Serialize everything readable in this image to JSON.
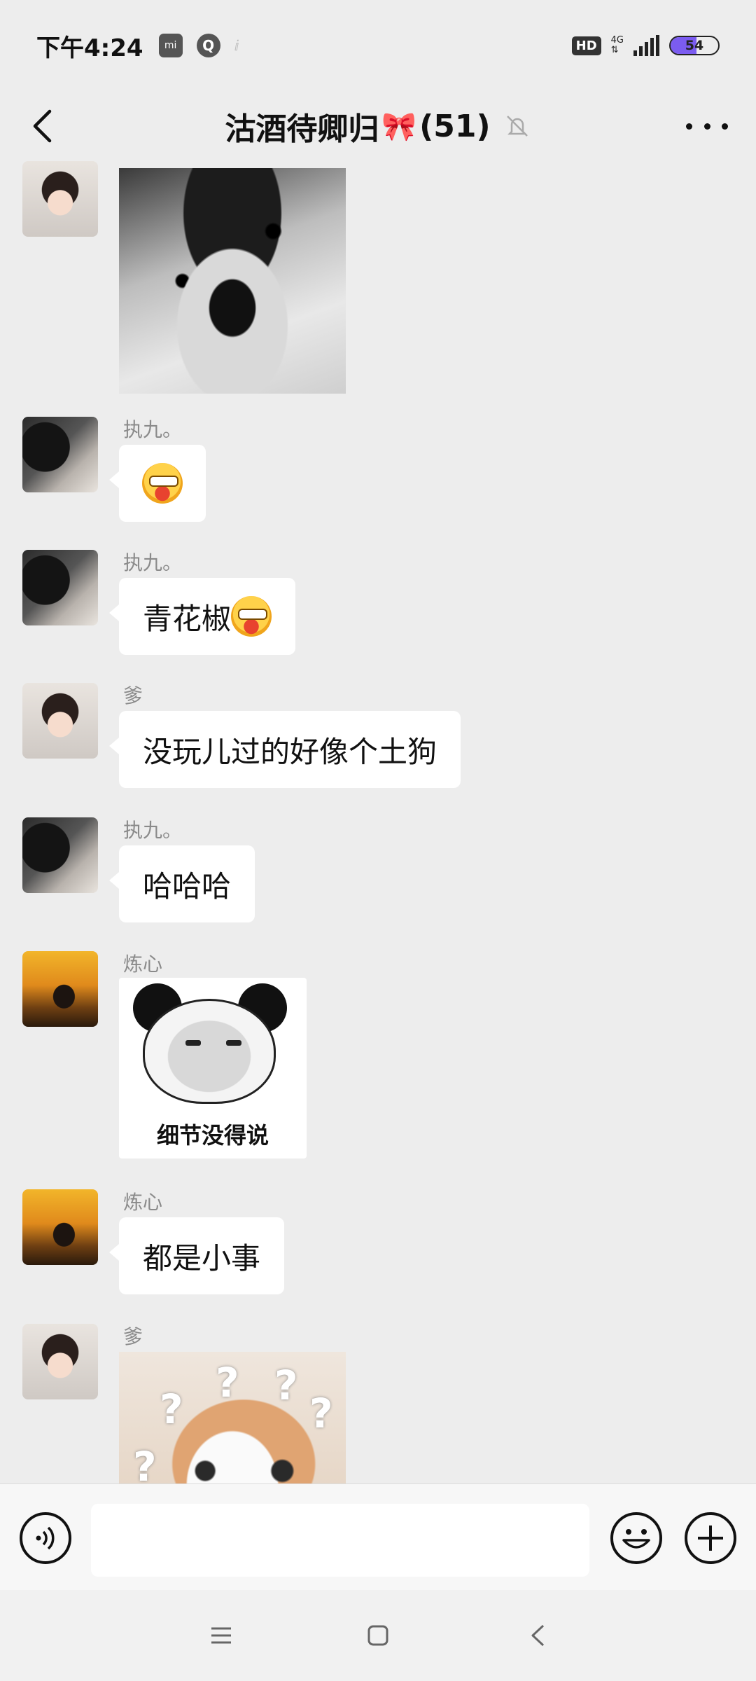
{
  "status_bar": {
    "time": "下午4:24",
    "mi_icon_label": "mi",
    "q_icon_label": "Q",
    "faint_icon": "ⅈ",
    "hd_label": "HD",
    "network_label": "4G",
    "network_arrows": "⇅",
    "battery_level": "54",
    "battery_fraction": 0.54
  },
  "header": {
    "title": "沽酒待卿归",
    "title_emoji": "🎀",
    "member_count": "(51)"
  },
  "messages": [
    {
      "type": "image",
      "sender": "爹",
      "avatar": "girl",
      "image": "husky-meme"
    },
    {
      "type": "text",
      "sender": "执九。",
      "avatar": "man",
      "text": ""
    },
    {
      "type": "text",
      "sender": "执九。",
      "avatar": "man",
      "text": "青花椒"
    },
    {
      "type": "text",
      "sender": "爹",
      "avatar": "girl",
      "text": "没玩儿过的好像个土狗"
    },
    {
      "type": "text",
      "sender": "执九。",
      "avatar": "man",
      "text": "哈哈哈"
    },
    {
      "type": "sticker",
      "sender": "炼心",
      "avatar": "sunset",
      "caption": "细节没得说"
    },
    {
      "type": "text",
      "sender": "炼心",
      "avatar": "sunset",
      "text": "都是小事"
    },
    {
      "type": "image",
      "sender": "爹",
      "avatar": "girl",
      "image": "cat-question-marks",
      "marks": [
        "?",
        "?",
        "?",
        "?",
        "?"
      ]
    }
  ],
  "input_bar": {
    "placeholder": ""
  },
  "colors": {
    "background": "#ededed",
    "bubble": "#ffffff",
    "battery_fill": "#7b5cf0"
  }
}
